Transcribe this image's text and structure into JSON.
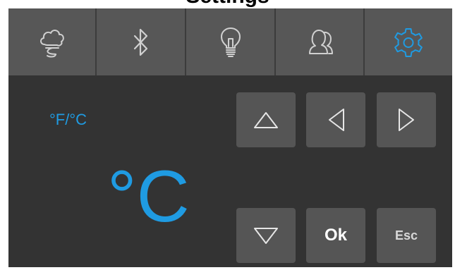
{
  "header": {
    "title": "Settings"
  },
  "tabs": [
    {
      "icon": "cloud-steam-icon",
      "active": false
    },
    {
      "icon": "bluetooth-icon",
      "active": false
    },
    {
      "icon": "lightbulb-icon",
      "active": false
    },
    {
      "icon": "users-icon",
      "active": false
    },
    {
      "icon": "gear-icon",
      "active": true
    }
  ],
  "setting": {
    "label": "°F/°C",
    "value": "°C"
  },
  "buttons": {
    "up_icon": "triangle-up-icon",
    "left_icon": "triangle-left-icon",
    "right_icon": "triangle-right-icon",
    "down_icon": "triangle-down-icon",
    "ok_label": "Ok",
    "esc_label": "Esc"
  },
  "colors": {
    "accent": "#1f9be2",
    "panel": "#333333",
    "tab": "#575757",
    "button": "#555555",
    "icon": "#d0d0d0"
  }
}
